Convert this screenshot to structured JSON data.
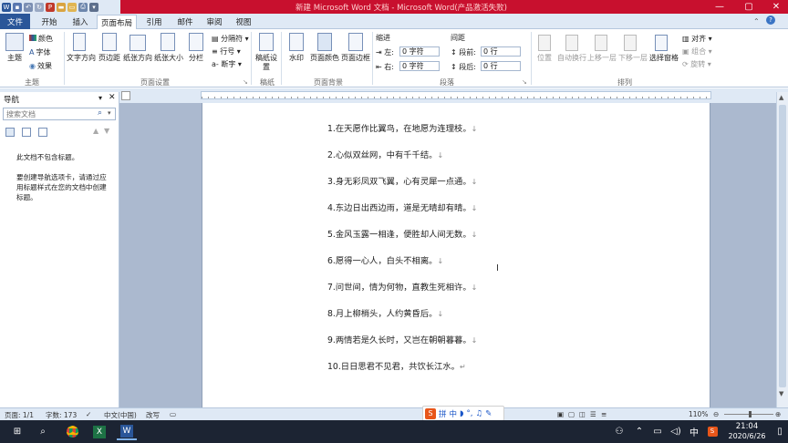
{
  "window": {
    "title": "新建 Microsoft Word 文档 - Microsoft Word(产品激活失败)",
    "minimize": "—",
    "maximize": "▢",
    "close": "✕"
  },
  "quick_access": [
    "save-icon",
    "undo-icon",
    "redo-icon",
    "pdf-icon",
    "folder-icon",
    "open-icon",
    "print-icon"
  ],
  "tabs": [
    {
      "label": "文件"
    },
    {
      "label": "开始"
    },
    {
      "label": "插入"
    },
    {
      "label": "页面布局"
    },
    {
      "label": "引用"
    },
    {
      "label": "邮件"
    },
    {
      "label": "审阅"
    },
    {
      "label": "视图"
    }
  ],
  "ribbon": {
    "theme": {
      "themes": "主题",
      "colors": "颜色",
      "fonts": "字体",
      "effects": "效果",
      "group": "主题"
    },
    "page_setup": {
      "text_dir": "文字方向",
      "margins": "页边距",
      "orientation": "纸张方向",
      "size": "纸张大小",
      "columns": "分栏",
      "breaks": "分隔符",
      "line_numbers": "行号",
      "hyphenation": "断字",
      "group": "页面设置"
    },
    "draft": {
      "settings": "稿纸设置",
      "group": "稿纸"
    },
    "background": {
      "watermark": "水印",
      "page_color": "页面颜色",
      "page_borders": "页面边框",
      "group": "页面背景"
    },
    "paragraph": {
      "indent": "缩进",
      "left": "左:",
      "left_val": "0 字符",
      "right": "右:",
      "right_val": "0 字符",
      "spacing": "间距",
      "before": "段前:",
      "before_val": "0 行",
      "after": "段后:",
      "after_val": "0 行",
      "group": "段落"
    },
    "arrange": {
      "position": "位置",
      "wrap": "自动换行",
      "forward": "上移一层",
      "backward": "下移一层",
      "selection": "选择窗格",
      "align": "对齐",
      "grouping": "组合",
      "rotate": "旋转",
      "group": "排列"
    }
  },
  "nav": {
    "title": "导航",
    "search_placeholder": "搜索文档",
    "empty_title": "此文档不包含标题。",
    "empty_desc": "要创建导航选项卡，请通过应用标题样式在您的文档中创建标题。"
  },
  "document": {
    "lines": [
      "1.在天愿作比翼鸟，在地愿为连理枝。",
      "2.心似双丝网，中有千千结。",
      "3.身无彩凤双飞翼，心有灵犀一点通。",
      "4.东边日出西边雨，道是无晴却有晴。",
      "5.金风玉露一相逢，便胜却人间无数。",
      "6.愿得一心人，白头不相离。",
      "7.问世间，情为何物，直教生死相许。",
      "8.月上柳梢头，人约黄昏后。",
      "9.两情若是久长时，又岂在朝朝暮暮。",
      "10.日日思君不见君，共饮长江水。"
    ],
    "para_mark": "↓",
    "end_mark": "↵"
  },
  "status": {
    "page": "页面: 1/1",
    "words": "字数: 173",
    "language": "中文(中国)",
    "mode": "改写",
    "zoom": "110%",
    "zoom_level": 110
  },
  "ime": {
    "label": "中"
  },
  "taskbar": {
    "time": "21:04",
    "date": "2020/6/26",
    "ime_lang": "中"
  }
}
